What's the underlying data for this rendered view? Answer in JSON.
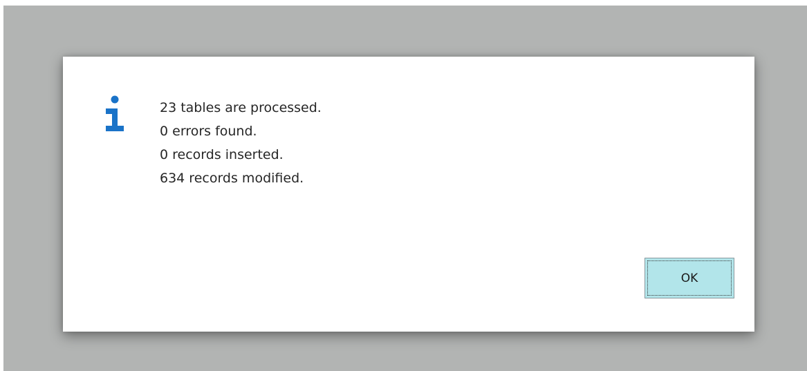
{
  "dialog": {
    "icon": "info-icon",
    "icon_color": "#1a73c8",
    "message_lines": [
      "23 tables are processed.",
      "0 errors found.",
      "0 records inserted.",
      "634 records modified."
    ],
    "ok_label": "OK"
  },
  "colors": {
    "backdrop": "#b2b4b3",
    "dialog_background": "#ffffff",
    "button_background": "#b2e5ea",
    "text": "#262626"
  }
}
